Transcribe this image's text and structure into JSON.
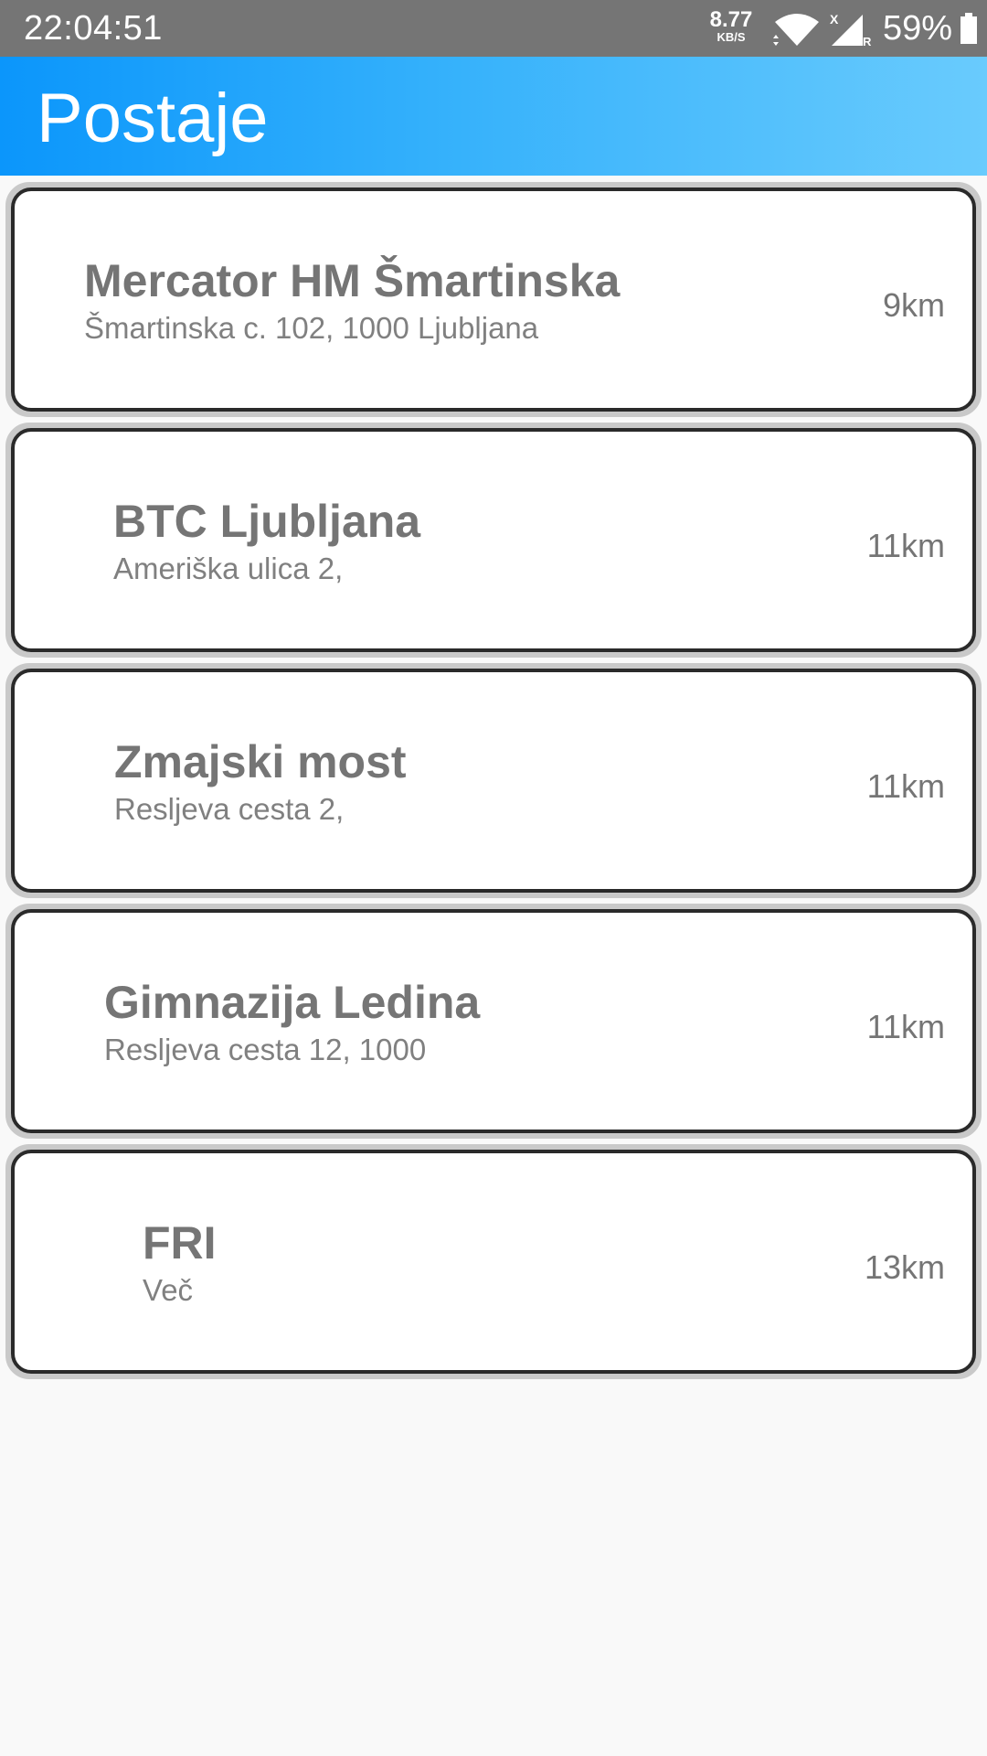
{
  "status_bar": {
    "time": "22:04:51",
    "net_speed": "8.77",
    "net_speed_unit": "KB/S",
    "signal_x": "X",
    "signal_r": "R",
    "battery": "59%"
  },
  "app_bar": {
    "title": "Postaje"
  },
  "stations": [
    {
      "name": "Mercator HM Šmartinska",
      "address": "Šmartinska c. 102, 1000 Ljubljana",
      "distance": "9km"
    },
    {
      "name": "BTC Ljubljana",
      "address": "Ameriška ulica 2,",
      "distance": "11km"
    },
    {
      "name": "Zmajski most",
      "address": "Resljeva cesta 2,",
      "distance": "11km"
    },
    {
      "name": "Gimnazija Ledina",
      "address": "Resljeva cesta 12, 1000",
      "distance": "11km"
    },
    {
      "name": "FRI",
      "address": "Več",
      "distance": "13km"
    }
  ],
  "colors": {
    "status_bar": "#757575",
    "app_bar_start": "#0b96fb",
    "app_bar_end": "#69cbfd",
    "card_border": "#2a2a2a",
    "card_text": "#757575",
    "background": "#f9f9f9"
  },
  "icons": [
    "wifi-icon",
    "signal-icon",
    "battery-icon"
  ]
}
